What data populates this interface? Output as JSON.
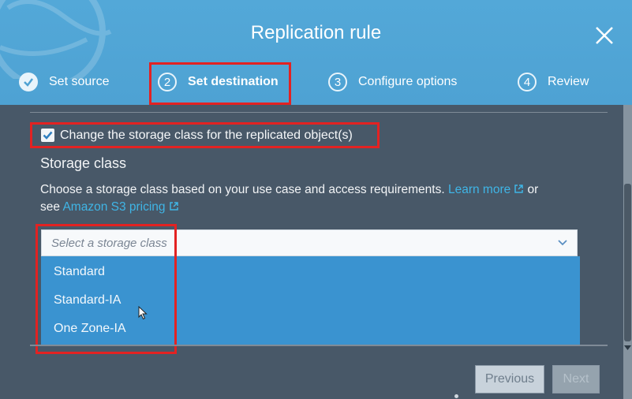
{
  "dialog": {
    "title": "Replication rule",
    "close_icon": "close-icon"
  },
  "steps": [
    {
      "number": "",
      "label": "Set source",
      "state": "completed",
      "icon": "check-icon"
    },
    {
      "number": "2",
      "label": "Set destination",
      "state": "active"
    },
    {
      "number": "3",
      "label": "Configure options",
      "state": "pending"
    },
    {
      "number": "4",
      "label": "Review",
      "state": "pending"
    }
  ],
  "storage": {
    "checkbox_label": "Change the storage class for the replicated object(s)",
    "checkbox_checked": true,
    "section_title": "Storage class",
    "description_1": "Choose a storage class based on your use case and access requirements.",
    "learn_more": "Learn more",
    "or": "or",
    "see": "see",
    "pricing_link": "Amazon S3 pricing",
    "select_placeholder": "Select a storage class",
    "options": [
      "Standard",
      "Standard-IA",
      "One Zone-IA"
    ]
  },
  "footer": {
    "previous": "Previous",
    "next": "Next"
  },
  "colors": {
    "header": "#4ea2d3",
    "body": "#485868",
    "dropdown": "#3a93d0",
    "highlight": "#e32222",
    "link": "#3fb5e6"
  }
}
